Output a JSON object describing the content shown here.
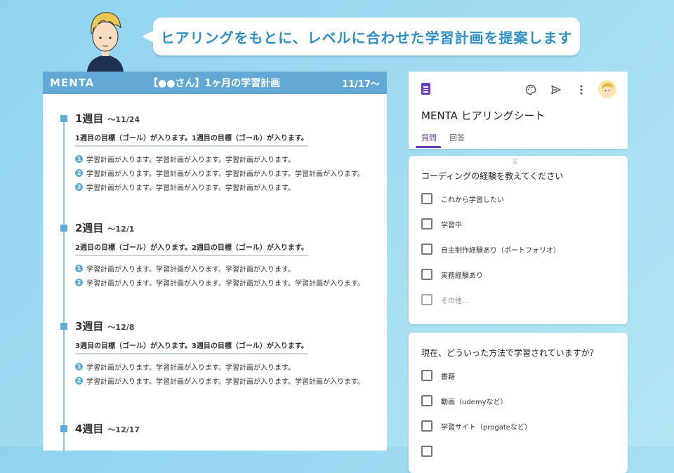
{
  "bubble": {
    "text": "ヒアリングをもとに、レベルに合わせた学習計画を提案します"
  },
  "plan": {
    "logo": "MENTA",
    "title": "【●●さん】1ヶ月の学習計画",
    "date": "11/17〜",
    "weeks": [
      {
        "label": "1週目",
        "date": "〜11/24",
        "goal": "1週目の目標（ゴール）が入ります。1週目の目標（ゴール）が入ります。",
        "items": [
          {
            "num": "1",
            "text": "学習計画が入ります。学習計画が入ります。学習計画が入ります。"
          },
          {
            "num": "2",
            "text": "学習計画が入ります。学習計画が入ります。学習計画が入ります。学習計画が入ります。"
          },
          {
            "num": "3",
            "text": "学習計画が入ります。学習計画が入ります。学習計画が入ります。"
          }
        ]
      },
      {
        "label": "2週目",
        "date": "〜12/1",
        "goal": "2週目の目標（ゴール）が入ります。2週目の目標（ゴール）が入ります。",
        "items": [
          {
            "num": "1",
            "text": "学習計画が入ります。学習計画が入ります。学習計画が入ります。"
          },
          {
            "num": "2",
            "text": "学習計画が入ります。学習計画が入ります。学習計画が入ります。学習計画が入ります。"
          }
        ]
      },
      {
        "label": "3週目",
        "date": "〜12/8",
        "goal": "3週目の目標（ゴール）が入ります。3週目の目標（ゴール）が入ります。",
        "items": [
          {
            "num": "1",
            "text": "学習計画が入ります。学習計画が入ります。学習計画が入ります。"
          },
          {
            "num": "2",
            "text": "学習計画が入ります。学習計画が入ります。学習計画が入ります。学習計画が入ります。"
          }
        ]
      },
      {
        "label": "4週目",
        "date": "〜12/17",
        "goal": "",
        "items": []
      }
    ]
  },
  "form": {
    "title": "MENTA ヒアリングシート",
    "tabs": [
      {
        "label": "質問",
        "active": true
      },
      {
        "label": "回答",
        "active": false
      }
    ],
    "toolbar_icons": [
      "palette-icon",
      "send-icon",
      "more-vert-icon",
      "user-avatar"
    ],
    "questions": [
      {
        "text": "コーディングの経験を教えてください",
        "options": [
          "これから学習したい",
          "学習中",
          "自主制作経験あり（ポートフォリオ）",
          "実務経験あり"
        ],
        "other": "その他..."
      },
      {
        "text": "現在、どういった方法で学習されていますか？",
        "options": [
          "書籍",
          "動画（udemyなど）",
          "学習サイト（progateなど）"
        ]
      }
    ]
  }
}
